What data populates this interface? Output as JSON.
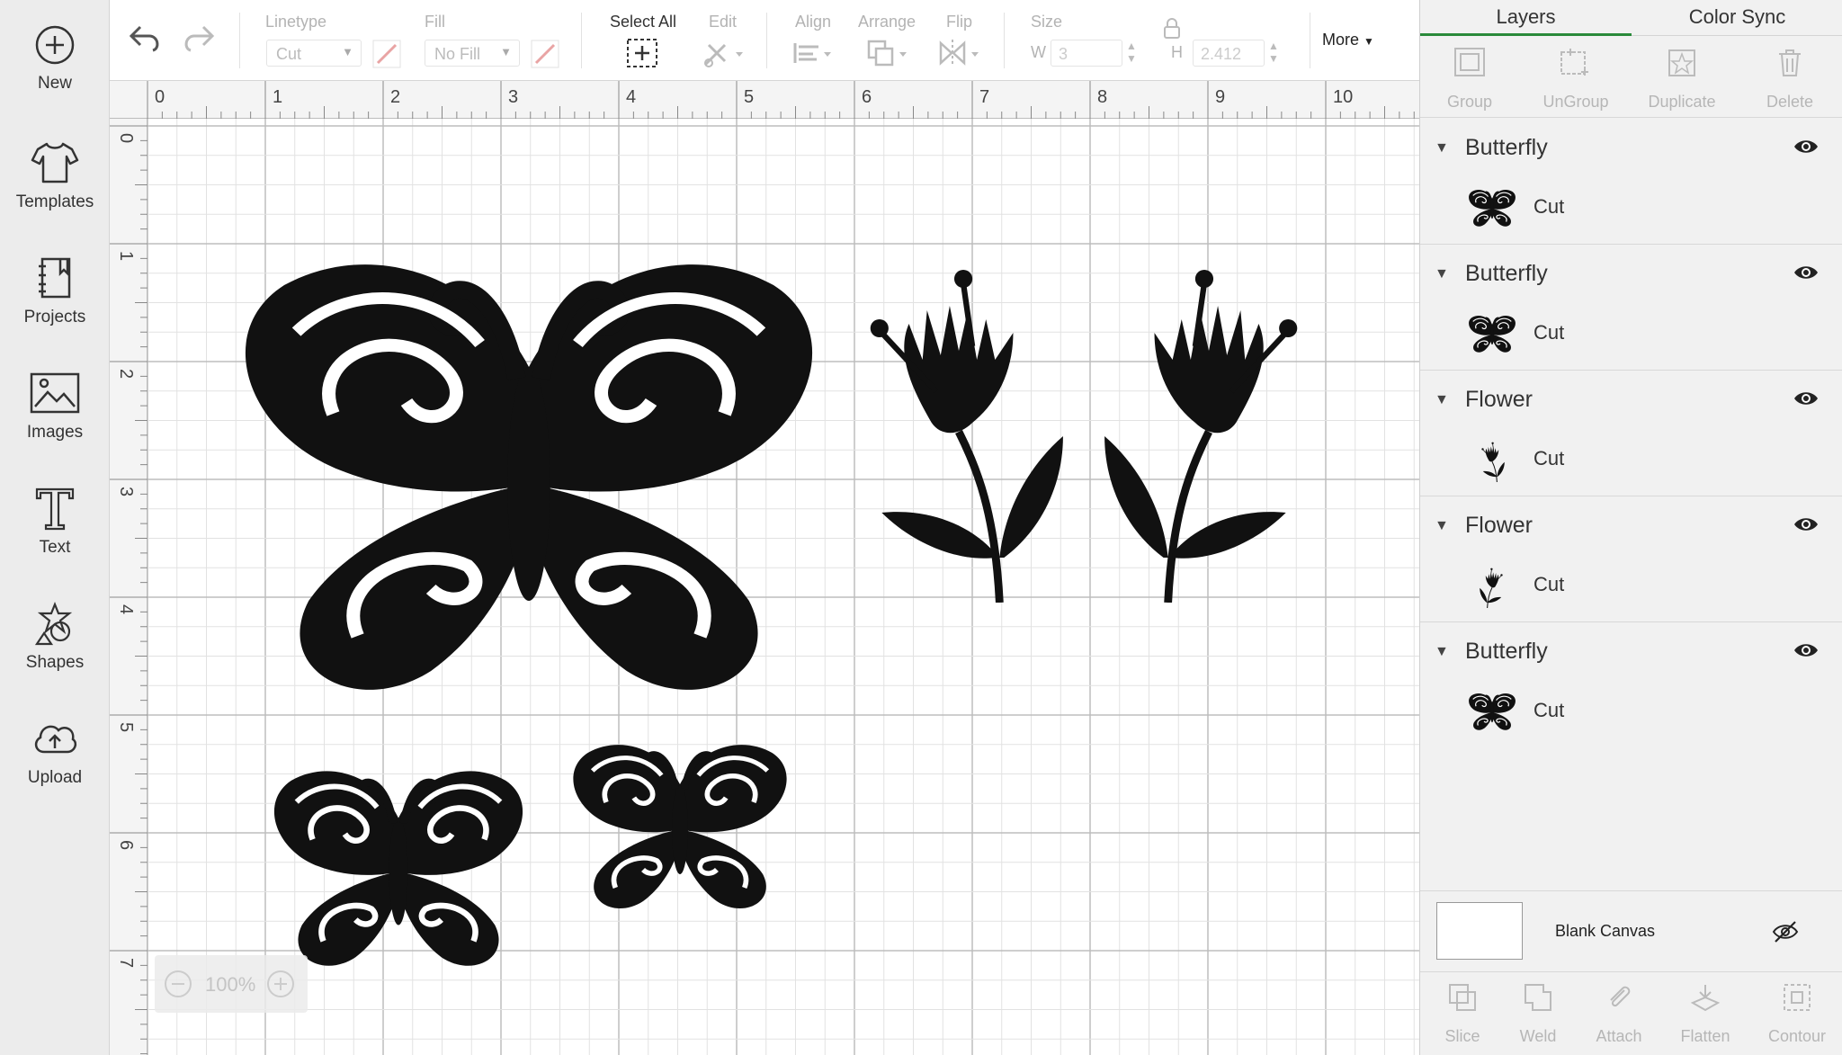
{
  "sidebar": {
    "items": [
      {
        "label": "New",
        "icon": "plus-circle-icon"
      },
      {
        "label": "Templates",
        "icon": "shirt-icon"
      },
      {
        "label": "Projects",
        "icon": "notebook-icon"
      },
      {
        "label": "Images",
        "icon": "image-icon"
      },
      {
        "label": "Text",
        "icon": "text-icon"
      },
      {
        "label": "Shapes",
        "icon": "shapes-icon"
      },
      {
        "label": "Upload",
        "icon": "cloud-upload-icon"
      }
    ]
  },
  "toolbar": {
    "linetype_label": "Linetype",
    "linetype_value": "Cut",
    "fill_label": "Fill",
    "fill_value": "No Fill",
    "select_all_label": "Select All",
    "edit_label": "Edit",
    "align_label": "Align",
    "arrange_label": "Arrange",
    "flip_label": "Flip",
    "size_label": "Size",
    "w_label": "W",
    "w_value": "3",
    "h_label": "H",
    "h_value": "2.412",
    "more_label": "More"
  },
  "ruler": {
    "top": [
      "0",
      "1",
      "2",
      "3",
      "4",
      "5",
      "6",
      "7",
      "8",
      "9",
      "10"
    ],
    "left": [
      "0",
      "1",
      "2",
      "3",
      "4",
      "5",
      "6",
      "7"
    ]
  },
  "zoom": {
    "value": "100%"
  },
  "panel": {
    "tabs": [
      {
        "label": "Layers",
        "active": true
      },
      {
        "label": "Color Sync",
        "active": false
      }
    ],
    "tools": [
      {
        "label": "Group",
        "icon": "group-icon"
      },
      {
        "label": "UnGroup",
        "icon": "ungroup-icon"
      },
      {
        "label": "Duplicate",
        "icon": "duplicate-icon"
      },
      {
        "label": "Delete",
        "icon": "trash-icon"
      }
    ],
    "layers": [
      {
        "name": "Butterfly",
        "operation": "Cut",
        "thumb": "butterfly"
      },
      {
        "name": "Butterfly",
        "operation": "Cut",
        "thumb": "butterfly"
      },
      {
        "name": "Flower",
        "operation": "Cut",
        "thumb": "flower"
      },
      {
        "name": "Flower",
        "operation": "Cut",
        "thumb": "flower"
      },
      {
        "name": "Butterfly",
        "operation": "Cut",
        "thumb": "butterfly"
      }
    ],
    "blank_canvas_label": "Blank Canvas",
    "bottom_tools": [
      {
        "label": "Slice",
        "icon": "slice-icon"
      },
      {
        "label": "Weld",
        "icon": "weld-icon"
      },
      {
        "label": "Attach",
        "icon": "paperclip-icon"
      },
      {
        "label": "Flatten",
        "icon": "flatten-icon"
      },
      {
        "label": "Contour",
        "icon": "contour-icon"
      }
    ]
  },
  "colors": {
    "accent": "#2a8a3a",
    "sidebar_bg": "#ececec",
    "panel_bg": "#f1f1f1"
  }
}
